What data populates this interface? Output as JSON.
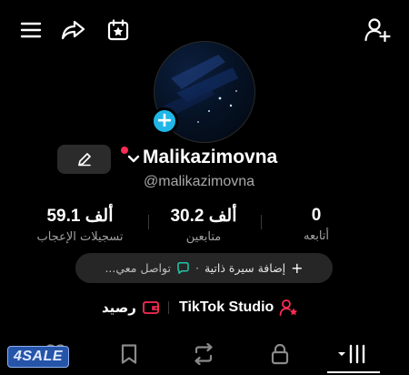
{
  "profile": {
    "username": "Malikazimovna",
    "handle": "@malikazimovna"
  },
  "stats": [
    {
      "value": "0",
      "label": "أتابعه"
    },
    {
      "value": "30.2 ألف",
      "label": "متابعين"
    },
    {
      "value": "59.1 ألف",
      "label": "تسجيلات الإعجاب"
    }
  ],
  "bio": {
    "add_bio": "إضافة سيرة ذاتية",
    "separator": "·",
    "contact": "تواصل معي..."
  },
  "links": {
    "studio": "TikTok Studio",
    "balance": "رصيد"
  },
  "topbar": {
    "icons": [
      "menu-icon",
      "share-icon",
      "calendar-star-icon",
      "add-friend-icon"
    ]
  },
  "tabs": [
    "videos-tab",
    "liked-tab",
    "favorites-tab",
    "reposts-tab",
    "private-tab"
  ],
  "watermark": "4SALE",
  "colors": {
    "background": "#000000",
    "accent_blue": "#20b7e8",
    "accent_red": "#fe2c55",
    "pill_bg": "#262626"
  }
}
